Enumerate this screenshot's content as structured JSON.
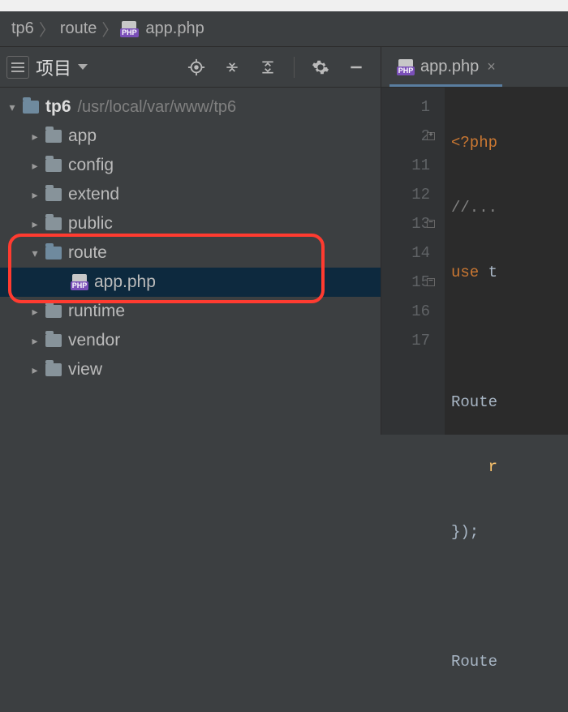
{
  "breadcrumb": {
    "root": "tp6",
    "folder": "route",
    "file": "app.php",
    "php_badge": "PHP"
  },
  "toolbar": {
    "panel_label": "项目"
  },
  "editor_tab": {
    "filename": "app.php",
    "php_badge": "PHP",
    "close": "×"
  },
  "tree": {
    "root_name": "tp6",
    "root_path": "/usr/local/var/www/tp6",
    "items": [
      {
        "name": "app"
      },
      {
        "name": "config"
      },
      {
        "name": "extend"
      },
      {
        "name": "public"
      },
      {
        "name": "route",
        "open": true,
        "child_file": "app.php"
      },
      {
        "name": "runtime"
      },
      {
        "name": "vendor"
      },
      {
        "name": "view"
      }
    ],
    "php_badge": "PHP"
  },
  "gutter_lines": [
    "1",
    "2",
    "11",
    "12",
    "13",
    "14",
    "15",
    "16",
    "17"
  ],
  "code": {
    "l1_tag": "<?php",
    "l2_comment": "//...",
    "l3_use": "use",
    "l3_rest": " t",
    "l5_route": "Route",
    "l6_r": "r",
    "l7_close": "});",
    "l9_route": "Route"
  }
}
